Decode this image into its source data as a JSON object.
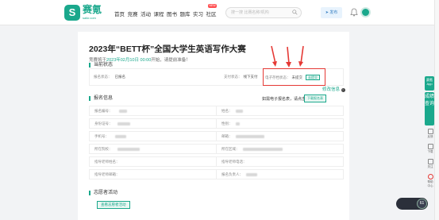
{
  "header": {
    "logo_glyph": "S",
    "logo_text": "赛氪",
    "logo_sub": "saikr.com",
    "nav": [
      "首页",
      "竞赛",
      "活动",
      "课程",
      "图书",
      "题库",
      "实习",
      "社区"
    ],
    "hot_badge": "NEW",
    "search_placeholder": "搜一搜 比赛名称/机构",
    "publish_label": "发布"
  },
  "contest": {
    "title": "2023年“BETT杯”全国大学生英语写作大赛",
    "subtitle_prefix": "竞赛将于",
    "subtitle_time": "2023年02月10日 00:00",
    "subtitle_suffix": "开始，请提前准备！"
  },
  "current_status": {
    "section": "当前状态",
    "signup_label": "报名状态：",
    "signup_value": "已报名",
    "payment_label": "支付状态：",
    "payment_value": "线下支付",
    "electronic_label": "电子存档状态：",
    "electronic_value": "未提交",
    "submit_btn": "去提交"
  },
  "edit_link": "修改信息",
  "signup_info": {
    "section": "报名信息",
    "hint": "如需电子报名表，请点击",
    "hint_btn": "下载报名表",
    "rows": [
      [
        "报名编号：",
        "姓名："
      ],
      [
        "身份证号：",
        "性别："
      ],
      [
        "手机号：",
        "邮箱："
      ],
      [
        "所在院校：",
        "所在区域："
      ],
      [
        "指导老师姓名：",
        "指导老师电话："
      ],
      [
        "指导老师邮箱：",
        "报名负责人："
      ]
    ]
  },
  "group": {
    "section": "志愿者活动",
    "btn": "查看志愿者活动"
  },
  "right_tools": {
    "app_label": "赛氪App",
    "score_label": "成绩查询",
    "tools": [
      "反馈",
      "下载",
      "关注",
      "帮助中心"
    ],
    "timer_label": "",
    "timer_value": "61"
  }
}
